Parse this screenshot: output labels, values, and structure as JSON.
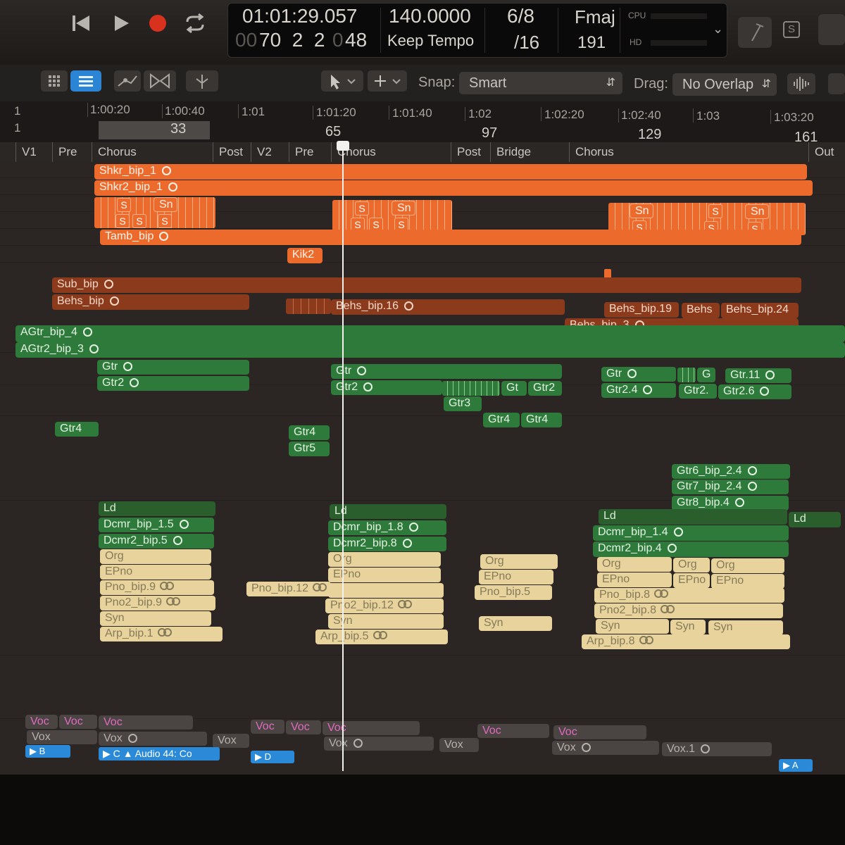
{
  "transport": {
    "time": "01:01:29.057",
    "bars_dim": "00",
    "bars": "70  2  2",
    "ticks_dim": "0",
    "ticks": "48",
    "tempo": "140.0000",
    "tempo_mode": "Keep Tempo",
    "sig_top": "6/8",
    "sig_bottom": "/16",
    "key": "Fmaj",
    "key_value": "191",
    "cpu_label": "CPU",
    "hd_label": "HD",
    "s_label": "S"
  },
  "toolbar": {
    "snap_label": "Snap:",
    "snap_value": "Smart",
    "drag_label": "Drag:",
    "drag_value": "No Overlap"
  },
  "ruler": {
    "times": [
      "1:00:20",
      "1:00:40",
      "1:01",
      "1:01:20",
      "1:01:40",
      "1:02",
      "1:02:20",
      "1:02:40",
      "1:03",
      "1:03:20"
    ],
    "bars": [
      "33",
      "65",
      "97",
      "129",
      "161"
    ],
    "left_a": "1",
    "left_b": "1"
  },
  "markers": [
    "V1",
    "Pre",
    "Chorus",
    "Post",
    "V2",
    "Pre",
    "Chorus",
    "Post",
    "Bridge",
    "Chorus",
    "Out"
  ],
  "regions": {
    "shkr1": "Shkr_bip_1",
    "shkr2": "Shkr2_bip_1",
    "tamb": "Tamb_bip",
    "kik2": "Kik2",
    "s": "S",
    "sn": "Sn",
    "sub": "Sub_bip",
    "behs": "Behs_bip",
    "behs16": "Behs_bip.16",
    "behs19": "Behs_bip.19",
    "behs_short": "Behs",
    "behs24": "Behs_bip.24",
    "behs3": "Behs_bip_3",
    "agtr4": "AGtr_bip_4",
    "agtr2": "AGtr2_bip_3",
    "gtr": "Gtr",
    "gtr2": "Gtr2",
    "gtr3": "Gtr3",
    "gtr4": "Gtr4",
    "gtr5": "Gtr5",
    "gt": "Gt",
    "g": "G",
    "gtr11": "Gtr.11",
    "gtr24": "Gtr2.4",
    "gtr2dot": "Gtr2.",
    "gtr26": "Gtr2.6",
    "gtr6": "Gtr6_bip_2.4",
    "gtr7": "Gtr7_bip_2.4",
    "gtr8": "Gtr8_bip.4",
    "ld": "Ld",
    "dcmr15": "Dcmr_bip_1.5",
    "dcmr25": "Dcmr2_bip.5",
    "dcmr18": "Dcmr_bip_1.8",
    "dcmr28": "Dcmr2_bip.8",
    "dcmr14": "Dcmr_bip_1.4",
    "dcmr24": "Dcmr2_bip.4",
    "org": "Org",
    "epno": "EPno",
    "pno9": "Pno_bip.9",
    "pno29": "Pno2_bip.9",
    "pno12": "Pno_bip.12",
    "pno212": "Pno2_bip.12",
    "pno5": "Pno_bip.5",
    "pno8": "Pno_bip.8",
    "pno28": "Pno2_bip.8",
    "syn": "Syn",
    "arp1": "Arp_bip.1",
    "arp5": "Arp_bip.5",
    "arp8": "Arp_bip.8",
    "voc": "Voc",
    "vox": "Vox",
    "vox1": "Vox.1",
    "audio44": "Audio 44: Co",
    "b": "B",
    "c": "C",
    "d": "D",
    "a": "A"
  }
}
